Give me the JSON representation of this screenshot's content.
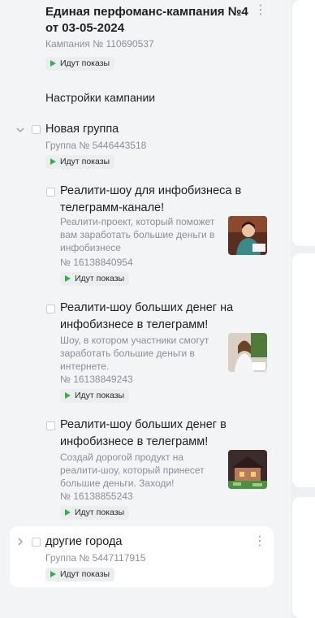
{
  "campaign": {
    "title": "Единая перфоманс-кампания №4 от 03-05-2024",
    "number": "Кампания № 110690537",
    "status": "Идут показы"
  },
  "settings_label": "Настройки кампании",
  "groups": [
    {
      "name": "Новая группа",
      "number": "Группа № 5446443518",
      "status": "Идут показы",
      "ads": [
        {
          "title": "Реалити-шоу для инфобизнеса в телеграмм-канале!",
          "description": "Реалити-проект, который поможет вам заработать большие деньги в инфобизнесе",
          "number": "№ 16138840954",
          "status": "Идут показы"
        },
        {
          "title": "Реалити-шоу больших денег на инфобизнесе в телеграмм!",
          "description": "Шоу, в котором участники смогут заработать большие деньги в интернете.",
          "number": "№ 16138849243",
          "status": "Идут показы"
        },
        {
          "title": "Реалити-шоу больших денег в инфобизнесе в телеграмм!",
          "description": "Создай дорогой продукт на реалити-шоу, который принесет большие деньги. Заходи!",
          "number": "№ 16138855243",
          "status": "Идут показы"
        }
      ]
    },
    {
      "name": "другие города",
      "number": "Группа № 5447117915",
      "status": "Идут показы"
    }
  ],
  "icons": {
    "more": "more-vertical-icon",
    "expand": "chevron-down-icon",
    "collapse": "chevron-right-icon",
    "status": "play-icon"
  },
  "colors": {
    "status_green": "#2fb24c",
    "badge_bg": "#ecedef",
    "muted_text": "#8a8f98"
  }
}
